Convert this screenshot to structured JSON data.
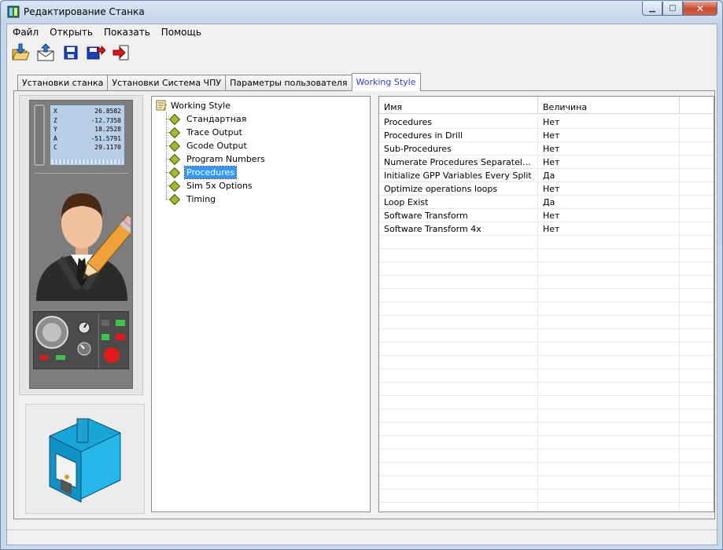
{
  "window": {
    "title": "Редактирование Станка"
  },
  "menu": [
    "Файл",
    "Открыть",
    "Показать",
    "Помощь"
  ],
  "toolbar": {
    "buttons": [
      {
        "name": "open-icon"
      },
      {
        "name": "mail-icon"
      },
      {
        "name": "save-icon"
      },
      {
        "name": "save-as-icon"
      },
      {
        "name": "exit-icon"
      }
    ]
  },
  "tabs": [
    "Установки станка",
    "Установки Система ЧПУ",
    "Параметры пользователя",
    "Working Style"
  ],
  "active_tab": 3,
  "dro": [
    {
      "axis": "X",
      "value": "26.8582"
    },
    {
      "axis": "Z",
      "value": "-12.7358"
    },
    {
      "axis": "Y",
      "value": "18.2528"
    },
    {
      "axis": "A",
      "value": "-51.5791"
    },
    {
      "axis": "C",
      "value": "29.1170"
    }
  ],
  "tree": {
    "root": "Working Style",
    "items": [
      "Стандартная",
      "Trace Output",
      "Gcode Output",
      "Program Numbers",
      "Procedures",
      "Sim 5x Options",
      "Timing"
    ],
    "selected": 4
  },
  "grid": {
    "headers": [
      "Имя",
      "Величина"
    ],
    "rows": [
      [
        "Procedures",
        "Нет"
      ],
      [
        "Procedures in Drill",
        "Нет"
      ],
      [
        "Sub-Procedures",
        "Нет"
      ],
      [
        "Numerate Procedures Separately for...",
        "Нет"
      ],
      [
        "Initialize GPP Variables Every Split",
        "Да"
      ],
      [
        "Optimize operations loops",
        "Нет"
      ],
      [
        "Loop Exist",
        "Да"
      ],
      [
        "Software Transform",
        "Нет"
      ],
      [
        "Software Transform 4x",
        "Нет"
      ]
    ],
    "empty_rows": 21
  },
  "colors": {
    "selection": "#3399ff",
    "active_tab_text": "#2a3fd0",
    "tree_icon": "#a8b832"
  }
}
